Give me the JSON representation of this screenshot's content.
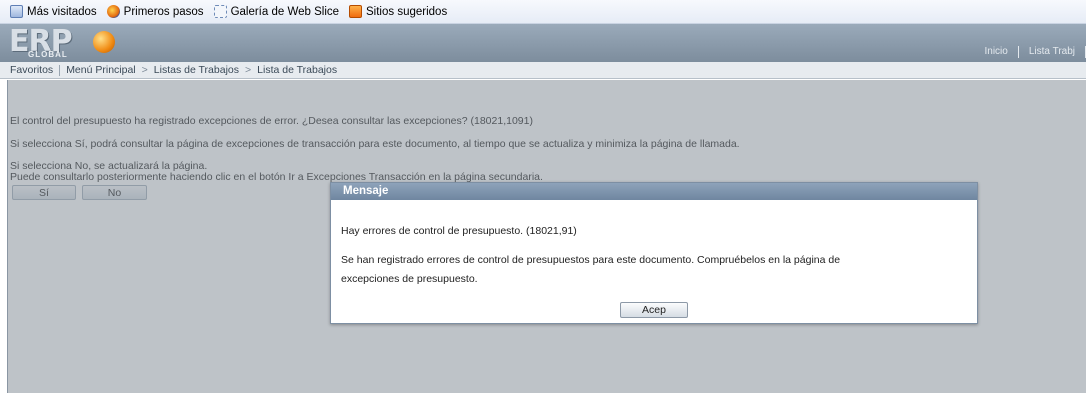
{
  "favorites_bar": {
    "items": [
      {
        "label": "Más visitados",
        "icon": "page-icon"
      },
      {
        "label": "Primeros pasos",
        "icon": "firefox-icon"
      },
      {
        "label": "Galería de Web Slice",
        "icon": "web-slice-icon"
      },
      {
        "label": "Sitios sugeridos",
        "icon": "suggested-sites-icon"
      }
    ]
  },
  "header": {
    "logo_text": "ERP",
    "logo_subtext": "GLOBAL",
    "links": [
      "Inicio",
      "Lista Trabj"
    ]
  },
  "nav": {
    "favoritos": "Favoritos",
    "menu_principal": "Menú Principal",
    "listas_trabajos": "Listas de Trabajos",
    "lista_trabajos": "Lista de Trabajos",
    "separator": ">"
  },
  "page": {
    "line1": "El control del presupuesto ha registrado excepciones de error. ¿Desea consultar las excepciones? (18021,1091)",
    "line2": "Si selecciona Sí, podrá consultar la página de excepciones de transacción para este documento, al tiempo que se actualiza y minimiza la página de llamada.",
    "line3": "Si selecciona No, se actualizará la página.",
    "line4": "Puede consultarlo posteriormente haciendo clic en el botón Ir a Excepciones Transacción en la página secundaria.",
    "yes_label": "Sí",
    "no_label": "No"
  },
  "modal": {
    "title": "Mensaje",
    "message1": "Hay errores de control de presupuesto. (18021,91)",
    "message2a": "Se han registrado errores  de control de presupuestos para este documento. Compruébelos en la página de",
    "message2b": "excepciones de presupuesto.",
    "ok_label": "Acep"
  },
  "colors": {
    "header": "#8a9aab",
    "modal_title": "#7f95ad",
    "overlay": "#7c8690"
  }
}
